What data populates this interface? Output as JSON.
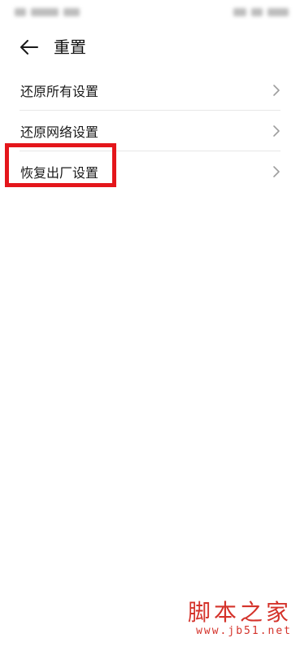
{
  "header": {
    "title": "重置",
    "back_icon": "arrow-left-icon"
  },
  "menu": {
    "items": [
      {
        "label": "还原所有设置",
        "icon": "chevron-right-icon"
      },
      {
        "label": "还原网络设置",
        "icon": "chevron-right-icon"
      },
      {
        "label": "恢复出厂设置",
        "icon": "chevron-right-icon",
        "highlighted": true
      }
    ]
  },
  "colors": {
    "text": "#1a1a1a",
    "divider": "#e7e7e7",
    "chevron": "#9e9e9e",
    "highlight": "#e4161b",
    "watermark": "#d4322a"
  },
  "watermark": {
    "title": "脚本之家",
    "url": "www.jb51.net"
  }
}
